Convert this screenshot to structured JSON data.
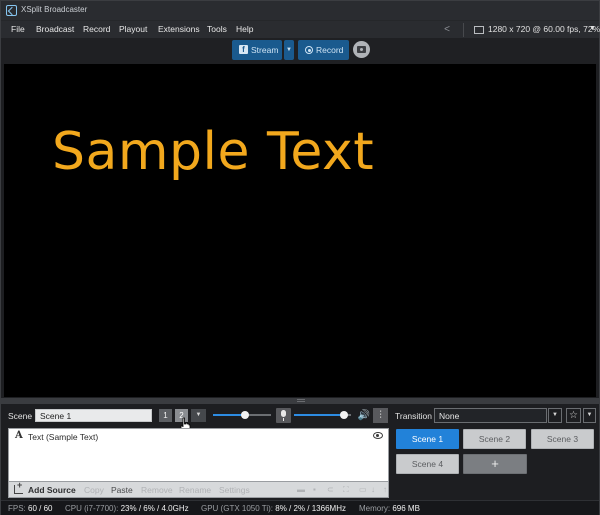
{
  "app": {
    "title": "XSplit Broadcaster"
  },
  "menu": {
    "items": [
      "File",
      "Broadcast",
      "Record",
      "Playout",
      "Extensions",
      "Tools",
      "Help"
    ],
    "resolution": "1280 x 720 @ 60.00 fps, 72%"
  },
  "toolbar": {
    "stream_label": "Stream",
    "record_label": "Record"
  },
  "preview": {
    "sample_text": "Sample Text",
    "sample_text_color": "#f2a81d"
  },
  "scene_bar": {
    "label": "Scene",
    "scene_name": "Scene 1",
    "pages": [
      "1",
      "2"
    ],
    "active_page": "2",
    "system_volume": 0.56,
    "mic_volume": 0.88,
    "transition_label": "Transition",
    "transition_value": "None"
  },
  "sources": {
    "items": [
      {
        "label": "Text (Sample Text)",
        "visible": true
      }
    ],
    "actions": {
      "add": "Add Source",
      "copy": "Copy",
      "paste": "Paste",
      "remove": "Remove",
      "rename": "Rename",
      "settings": "Settings"
    }
  },
  "scenes": {
    "buttons": [
      "Scene 1",
      "Scene 2",
      "Scene 3",
      "Scene 4"
    ],
    "active": "Scene 1",
    "add_label": "+",
    "accent": "#2282d9"
  },
  "status": {
    "fps_label": "FPS:",
    "fps_value": "60 / 60",
    "cpu_label": "CPU (i7-7700):",
    "cpu_value": "23% / 6% / 4.0GHz",
    "gpu_label": "GPU (GTX 1050 Ti):",
    "gpu_value": "8% / 2% / 1366MHz",
    "memory_label": "Memory:",
    "memory_value": "696 MB"
  }
}
